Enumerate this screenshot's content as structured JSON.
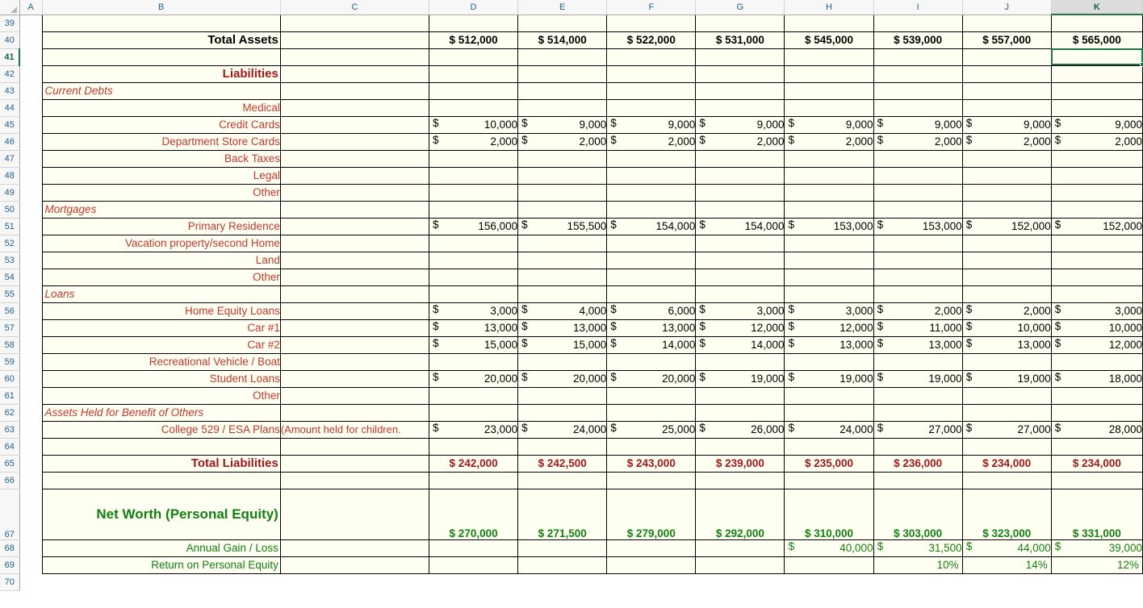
{
  "app": {
    "type": "spreadsheet",
    "name": "excel-worksheet"
  },
  "selection": {
    "active_cell": "K41",
    "active_column": "K",
    "active_row": "41"
  },
  "colors": {
    "label_red": "#c0392b",
    "header_red": "#a01818",
    "green": "#128012",
    "black": "#000000",
    "cell_bg": "#fffff2",
    "selection": "#217346"
  },
  "columns": [
    {
      "id": "A",
      "label": "A",
      "selected": false
    },
    {
      "id": "B",
      "label": "B",
      "selected": false
    },
    {
      "id": "C",
      "label": "C",
      "selected": false
    },
    {
      "id": "D",
      "label": "D",
      "selected": false
    },
    {
      "id": "E",
      "label": "E",
      "selected": false
    },
    {
      "id": "F",
      "label": "F",
      "selected": false
    },
    {
      "id": "G",
      "label": "G",
      "selected": false
    },
    {
      "id": "H",
      "label": "H",
      "selected": false
    },
    {
      "id": "I",
      "label": "I",
      "selected": false
    },
    {
      "id": "J",
      "label": "J",
      "selected": false
    },
    {
      "id": "K",
      "label": "K",
      "selected": true
    }
  ],
  "row_headers": [
    "39",
    "40",
    "41",
    "42",
    "43",
    "44",
    "45",
    "46",
    "47",
    "48",
    "49",
    "50",
    "51",
    "52",
    "53",
    "54",
    "55",
    "56",
    "57",
    "58",
    "59",
    "60",
    "61",
    "62",
    "63",
    "64",
    "65",
    "66",
    "67",
    "68",
    "69",
    "70"
  ],
  "chart_data": {
    "type": "table",
    "title": "Personal Net Worth Statement — Liabilities and Net Worth",
    "column_keys": [
      "D",
      "E",
      "F",
      "G",
      "H",
      "I",
      "J",
      "K"
    ],
    "rows": [
      {
        "row": "39",
        "label": "",
        "style": "blank",
        "values": [
          "",
          "",
          "",
          "",
          "",
          "",
          "",
          ""
        ]
      },
      {
        "row": "40",
        "label": "Total Assets",
        "style": "total-black",
        "values": [
          "$ 512,000",
          "$ 514,000",
          "$ 522,000",
          "$ 531,000",
          "$ 545,000",
          "$ 539,000",
          "$ 557,000",
          "$ 565,000"
        ]
      },
      {
        "row": "41",
        "label": "",
        "style": "blank",
        "values": [
          "",
          "",
          "",
          "",
          "",
          "",
          "",
          ""
        ]
      },
      {
        "row": "42",
        "label": "Liabilities",
        "style": "section-red",
        "values": [
          "",
          "",
          "",
          "",
          "",
          "",
          "",
          ""
        ]
      },
      {
        "row": "43",
        "label": "Current Debts",
        "style": "subhead",
        "values": [
          "",
          "",
          "",
          "",
          "",
          "",
          "",
          ""
        ]
      },
      {
        "row": "44",
        "label": "Medical",
        "style": "item",
        "values": [
          "",
          "",
          "",
          "",
          "",
          "",
          "",
          ""
        ]
      },
      {
        "row": "45",
        "label": "Credit Cards",
        "style": "item",
        "values": [
          "10,000",
          "9,000",
          "9,000",
          "9,000",
          "9,000",
          "9,000",
          "9,000",
          "9,000"
        ]
      },
      {
        "row": "46",
        "label": "Department Store Cards",
        "style": "item",
        "values": [
          "2,000",
          "2,000",
          "2,000",
          "2,000",
          "2,000",
          "2,000",
          "2,000",
          "2,000"
        ]
      },
      {
        "row": "47",
        "label": "Back Taxes",
        "style": "item",
        "values": [
          "",
          "",
          "",
          "",
          "",
          "",
          "",
          ""
        ]
      },
      {
        "row": "48",
        "label": "Legal",
        "style": "item",
        "values": [
          "",
          "",
          "",
          "",
          "",
          "",
          "",
          ""
        ]
      },
      {
        "row": "49",
        "label": "Other",
        "style": "item",
        "values": [
          "",
          "",
          "",
          "",
          "",
          "",
          "",
          ""
        ]
      },
      {
        "row": "50",
        "label": "Mortgages",
        "style": "subhead",
        "values": [
          "",
          "",
          "",
          "",
          "",
          "",
          "",
          ""
        ]
      },
      {
        "row": "51",
        "label": "Primary Residence",
        "style": "item",
        "values": [
          "156,000",
          "155,500",
          "154,000",
          "154,000",
          "153,000",
          "153,000",
          "152,000",
          "152,000"
        ]
      },
      {
        "row": "52",
        "label": "Vacation property/second Home",
        "style": "item",
        "values": [
          "",
          "",
          "",
          "",
          "",
          "",
          "",
          ""
        ]
      },
      {
        "row": "53",
        "label": "Land",
        "style": "item",
        "values": [
          "",
          "",
          "",
          "",
          "",
          "",
          "",
          ""
        ]
      },
      {
        "row": "54",
        "label": "Other",
        "style": "item",
        "values": [
          "",
          "",
          "",
          "",
          "",
          "",
          "",
          ""
        ]
      },
      {
        "row": "55",
        "label": "Loans",
        "style": "subhead",
        "values": [
          "",
          "",
          "",
          "",
          "",
          "",
          "",
          ""
        ]
      },
      {
        "row": "56",
        "label": "Home Equity Loans",
        "style": "item",
        "values": [
          "3,000",
          "4,000",
          "6,000",
          "3,000",
          "3,000",
          "2,000",
          "2,000",
          "3,000"
        ]
      },
      {
        "row": "57",
        "label": "Car #1",
        "style": "item",
        "values": [
          "13,000",
          "13,000",
          "13,000",
          "12,000",
          "12,000",
          "11,000",
          "10,000",
          "10,000"
        ]
      },
      {
        "row": "58",
        "label": "Car #2",
        "style": "item",
        "values": [
          "15,000",
          "15,000",
          "14,000",
          "14,000",
          "13,000",
          "13,000",
          "13,000",
          "12,000"
        ]
      },
      {
        "row": "59",
        "label": "Recreational Vehicle / Boat",
        "style": "item",
        "values": [
          "",
          "",
          "",
          "",
          "",
          "",
          "",
          ""
        ]
      },
      {
        "row": "60",
        "label": "Student Loans",
        "style": "item",
        "values": [
          "20,000",
          "20,000",
          "20,000",
          "19,000",
          "19,000",
          "19,000",
          "19,000",
          "18,000"
        ]
      },
      {
        "row": "61",
        "label": "Other",
        "style": "item",
        "values": [
          "",
          "",
          "",
          "",
          "",
          "",
          "",
          ""
        ]
      },
      {
        "row": "62",
        "label": "Assets Held for Benefit of Others",
        "style": "subhead",
        "values": [
          "",
          "",
          "",
          "",
          "",
          "",
          "",
          ""
        ]
      },
      {
        "row": "63",
        "label": "College 529 / ESA Plans",
        "style": "item",
        "note": "(Amount held for children.",
        "values": [
          "23,000",
          "24,000",
          "25,000",
          "26,000",
          "24,000",
          "27,000",
          "27,000",
          "28,000"
        ]
      },
      {
        "row": "64",
        "label": "",
        "style": "blank",
        "values": [
          "",
          "",
          "",
          "",
          "",
          "",
          "",
          ""
        ]
      },
      {
        "row": "65",
        "label": "Total Liabilities",
        "style": "total-red",
        "values": [
          "$ 242,000",
          "$ 242,500",
          "$ 243,000",
          "$ 239,000",
          "$ 235,000",
          "$ 236,000",
          "$ 234,000",
          "$ 234,000"
        ]
      },
      {
        "row": "66",
        "label": "",
        "style": "blank",
        "values": [
          "",
          "",
          "",
          "",
          "",
          "",
          "",
          ""
        ]
      },
      {
        "row": "67",
        "label": "Net Worth (Personal Equity)",
        "style": "total-green-tall",
        "values": [
          "$ 270,000",
          "$ 271,500",
          "$ 279,000",
          "$ 292,000",
          "$ 310,000",
          "$ 303,000",
          "$ 323,000",
          "$ 331,000"
        ]
      },
      {
        "row": "68",
        "label": "Annual Gain / Loss",
        "style": "item-green",
        "values": [
          "",
          "",
          "",
          "",
          "40,000",
          "31,500",
          "44,000",
          "39,000"
        ]
      },
      {
        "row": "69",
        "label": "Return on Personal Equity",
        "style": "item-green",
        "values": [
          "",
          "",
          "",
          "",
          "",
          "10%",
          "14%",
          "12%"
        ]
      },
      {
        "row": "70",
        "label": "",
        "style": "outside",
        "values": [
          "",
          "",
          "",
          "",
          "",
          "",
          "",
          ""
        ]
      }
    ],
    "currency_symbol": "$"
  }
}
